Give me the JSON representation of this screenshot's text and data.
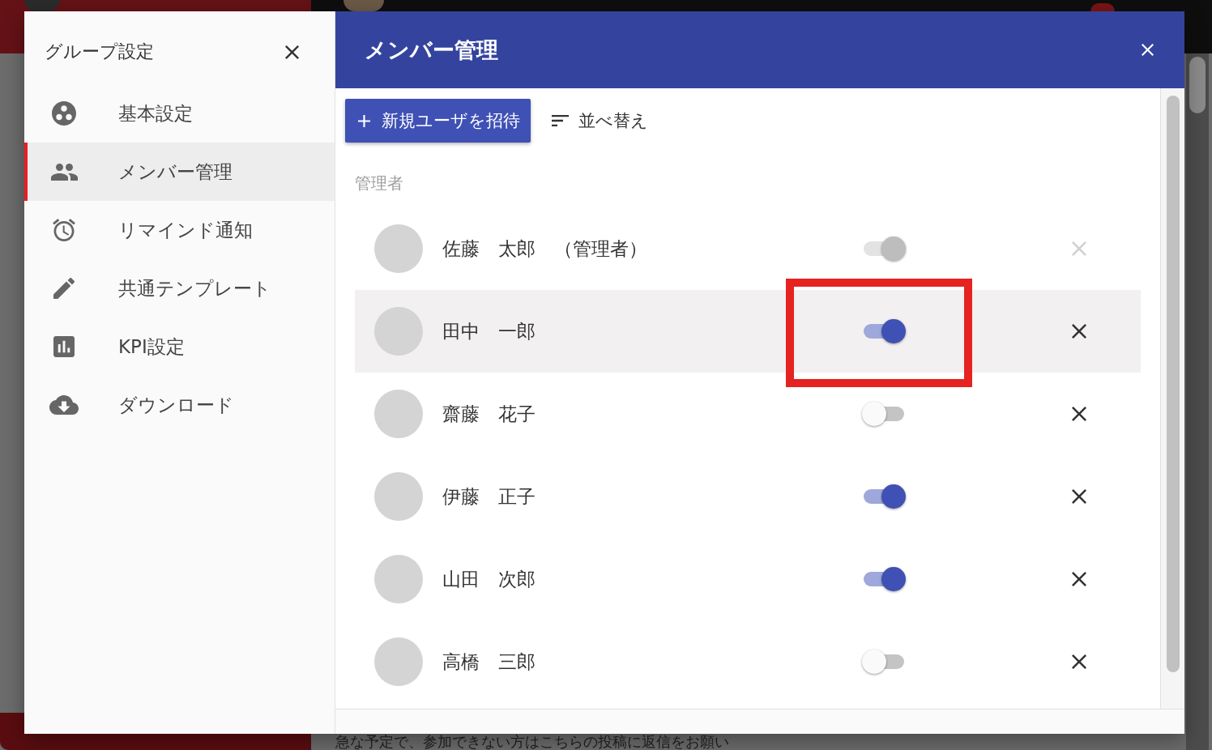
{
  "background": {
    "message_preview": "急な予定で、参加できない方はこちらの投稿に返信をお願い"
  },
  "sidebar": {
    "title": "グループ設定",
    "items": [
      {
        "kind": "group",
        "label": "基本設定",
        "selected": false
      },
      {
        "kind": "members",
        "label": "メンバー管理",
        "selected": true
      },
      {
        "kind": "reminder",
        "label": "リマインド通知",
        "selected": false
      },
      {
        "kind": "template",
        "label": "共通テンプレート",
        "selected": false
      },
      {
        "kind": "kpi",
        "label": "KPI設定",
        "selected": false
      },
      {
        "kind": "download",
        "label": "ダウンロード",
        "selected": false
      }
    ]
  },
  "panel": {
    "title": "メンバー管理",
    "invite_button": {
      "label": "新規ユーザを招待"
    },
    "sort_button": {
      "label": "並べ替え"
    },
    "section_label": "管理者",
    "members": [
      {
        "name": "佐藤　太郎　（管理者）",
        "on": true,
        "disabled": true,
        "highlighted": false,
        "annotated": false
      },
      {
        "name": "田中　一郎",
        "on": true,
        "disabled": false,
        "highlighted": true,
        "annotated": true
      },
      {
        "name": "齋藤　花子",
        "on": false,
        "disabled": false,
        "highlighted": false,
        "annotated": false
      },
      {
        "name": "伊藤　正子",
        "on": true,
        "disabled": false,
        "highlighted": false,
        "annotated": false
      },
      {
        "name": "山田　次郎",
        "on": true,
        "disabled": false,
        "highlighted": false,
        "annotated": false
      },
      {
        "name": "高橋　三郎",
        "on": false,
        "disabled": false,
        "highlighted": false,
        "annotated": false
      }
    ]
  }
}
